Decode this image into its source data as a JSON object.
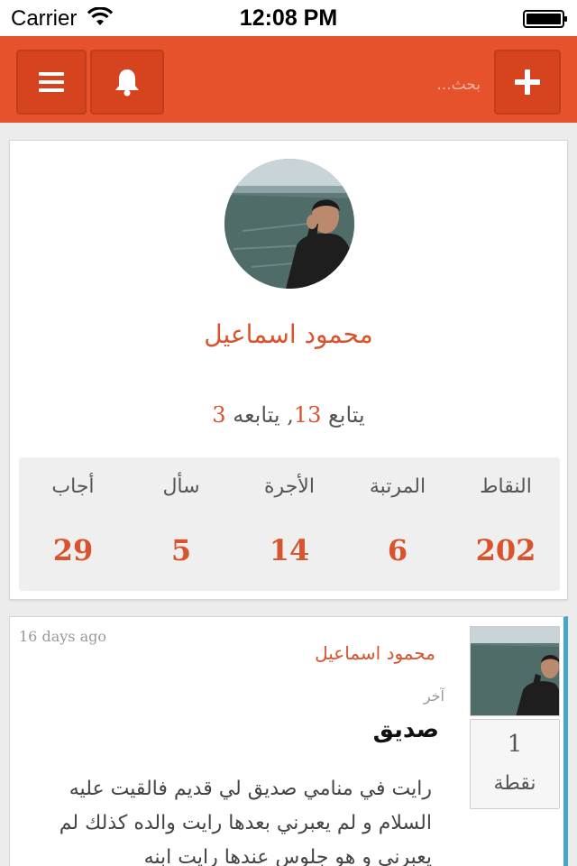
{
  "status_bar": {
    "carrier": "Carrier",
    "time": "12:08 PM"
  },
  "header": {
    "search_placeholder": "بحث...",
    "accent_color": "#e6522c"
  },
  "profile": {
    "name": "محمود اسماعيل",
    "following_label": "يتابع",
    "following_count": "13",
    "followers_label": "يتابعه",
    "followers_count": "3",
    "stats": [
      {
        "label": "النقاط",
        "value": "202"
      },
      {
        "label": "المرتبة",
        "value": "6"
      },
      {
        "label": "الأجرة",
        "value": "14"
      },
      {
        "label": "سأل",
        "value": "5"
      },
      {
        "label": "أجاب",
        "value": "29"
      }
    ]
  },
  "post": {
    "time": "16 days ago",
    "author": "محمود اسماعيل",
    "category": "آخر",
    "title": "صديق",
    "body": "رايت في منامي صديق لي قديم فالقيت عليه السلام و لم يعبرني بعدها رايت والده كذلك لم يعبرني و هو جلوس عندها رايت ابنه",
    "points_value": "1",
    "points_label": "نقطة"
  }
}
